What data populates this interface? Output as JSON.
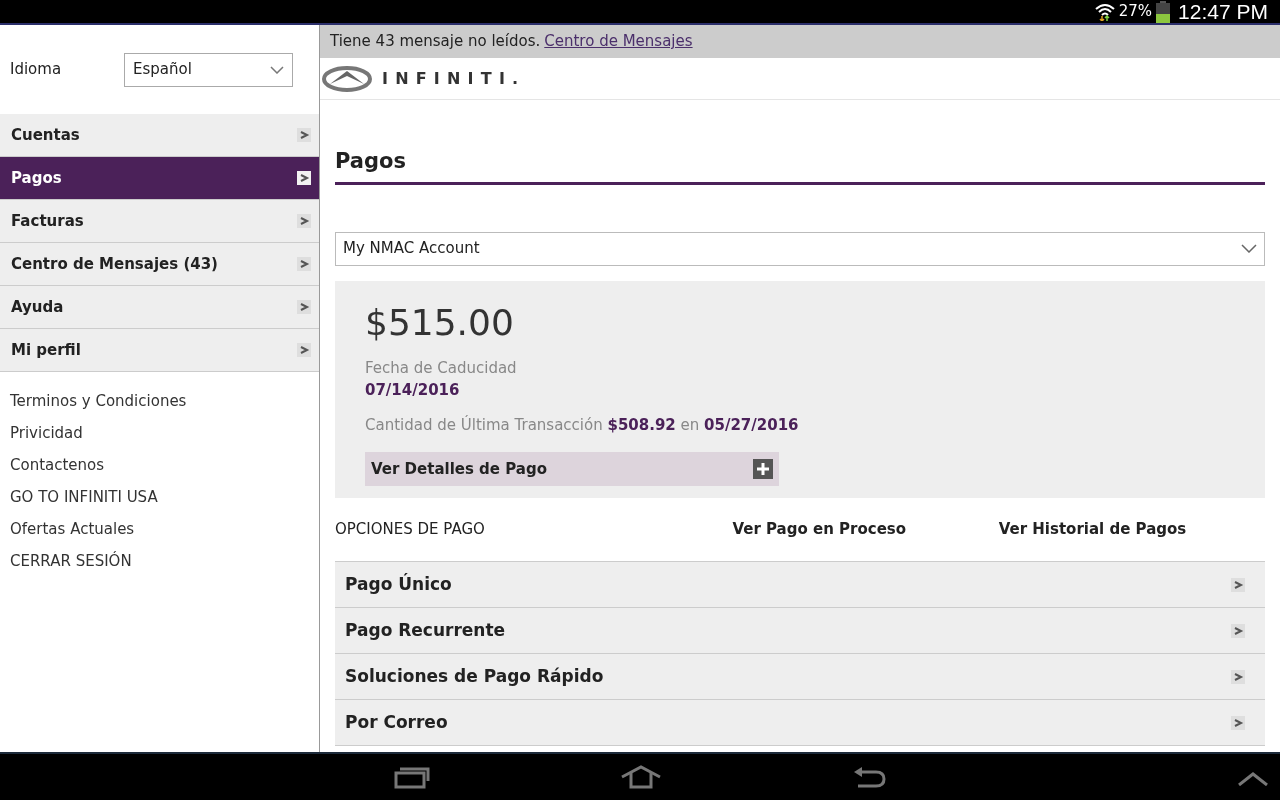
{
  "status_bar": {
    "battery_percent": "27%",
    "time": "12:47 PM"
  },
  "sidebar": {
    "language_label": "Idioma",
    "language_value": "Español",
    "menu": [
      {
        "label": "Cuentas",
        "selected": false
      },
      {
        "label": "Pagos",
        "selected": true
      },
      {
        "label": "Facturas",
        "selected": false
      },
      {
        "label": "Centro de Mensajes (43)",
        "selected": false
      },
      {
        "label": "Ayuda",
        "selected": false
      },
      {
        "label": "Mi perfil",
        "selected": false
      }
    ],
    "links": [
      "Terminos y Condiciones",
      "Privicidad",
      "Contactenos",
      "GO TO INFINITI USA",
      "Ofertas Actuales",
      "CERRAR SESIÓN"
    ]
  },
  "message_bar": {
    "text": "Tiene 43 mensaje no leídos.",
    "link": "Centro de Mensajes"
  },
  "logo": {
    "text": "INFINITI."
  },
  "page": {
    "title": "Pagos",
    "account_select": "My NMAC Account",
    "summary": {
      "amount": "$515.00",
      "due_label": "Fecha de Caducidad",
      "due_date": "07/14/2016",
      "last_transaction": "Cantidad de Última Transacción **$508.92** en **05/27/2016**",
      "details_button": "Ver Detalles de Pago"
    },
    "options_header": {
      "title": "OPCIONES DE PAGO",
      "links": [
        "Ver Pago en Proceso",
        "Ver Historial de Pagos"
      ]
    },
    "options": [
      "Pago Único",
      "Pago Recurrente",
      "Soluciones de Pago Rápido",
      "Por Correo"
    ]
  }
}
